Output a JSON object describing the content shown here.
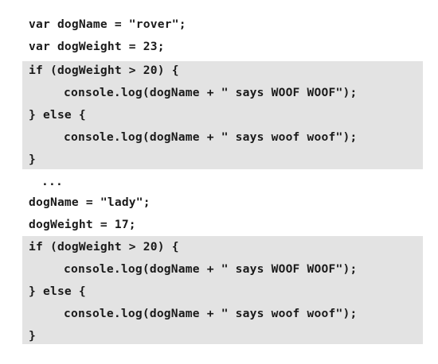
{
  "block1": {
    "decl_name": "var dogName = \"rover\";",
    "decl_weight": "var dogWeight = 23;",
    "if_line": "if (dogWeight > 20) {",
    "loud_log": "console.log(dogName + \" says WOOF WOOF\");",
    "else_line": "} else {",
    "soft_log": "console.log(dogName + \" says woof woof\");",
    "close_brace": "}"
  },
  "ellipsis": "...",
  "block2": {
    "assign_name": "dogName = \"lady\";",
    "assign_weight": "dogWeight = 17;",
    "if_line": "if (dogWeight > 20) {",
    "loud_log": "console.log(dogName + \" says WOOF WOOF\");",
    "else_line": "} else {",
    "soft_log": "console.log(dogName + \" says woof woof\");",
    "close_brace": "}"
  },
  "colors": {
    "text": "#1a1a1a",
    "highlight": "#e3e3e3",
    "background": "#ffffff"
  }
}
